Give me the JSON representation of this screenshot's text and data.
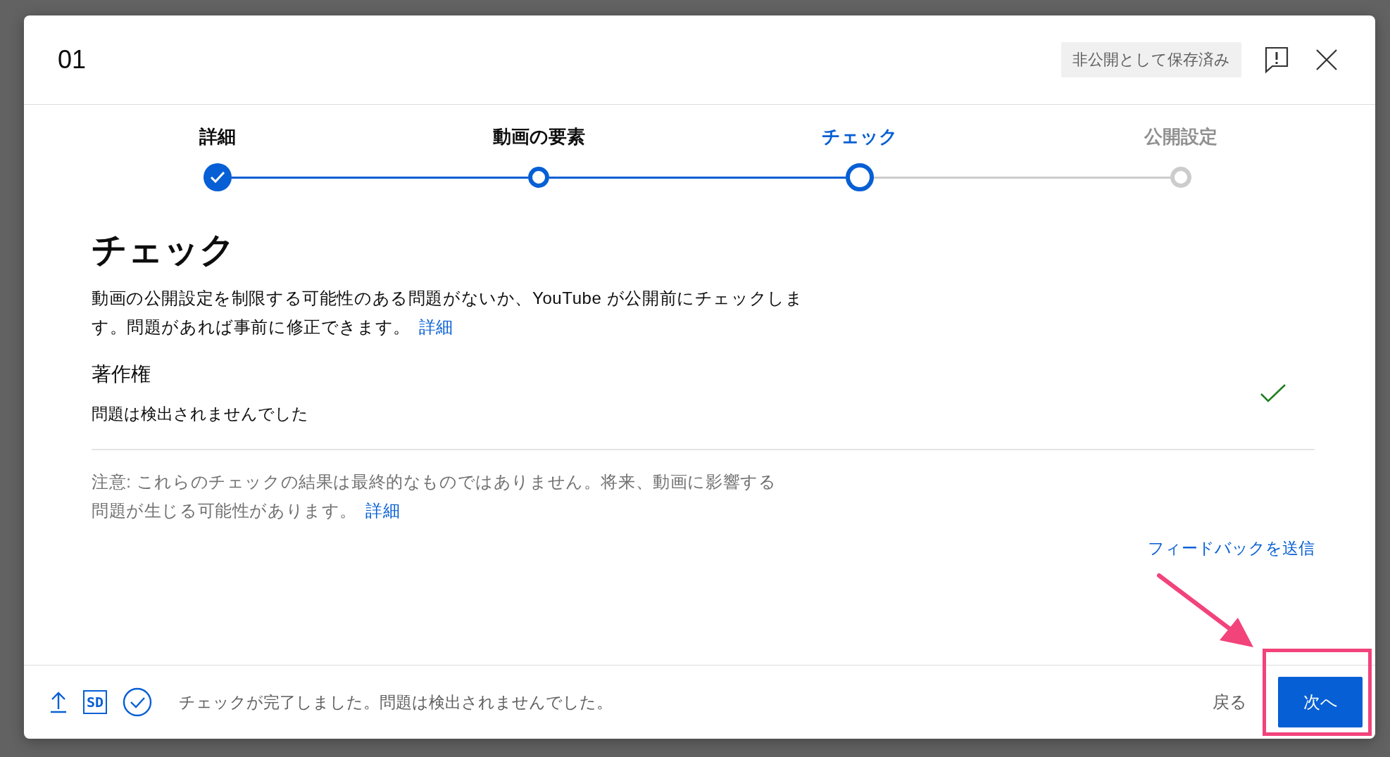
{
  "dialog": {
    "title": "01",
    "save_status": "非公開として保存済み"
  },
  "steps": [
    {
      "label": "詳細",
      "checked": true,
      "completed": true,
      "selected": false
    },
    {
      "label": "動画の要素",
      "checked": false,
      "completed": true,
      "selected": false
    },
    {
      "label": "チェック",
      "checked": false,
      "completed": false,
      "selected": true
    },
    {
      "label": "公開設定",
      "checked": false,
      "completed": false,
      "selected": false
    }
  ],
  "content": {
    "heading": "チェック",
    "description": "動画の公開設定を制限する可能性のある問題がないか、YouTube が公開前にチェックします。問題があれば事前に修正できます。",
    "description_link": "詳細",
    "checks": [
      {
        "title": "著作権",
        "result": "問題は検出されませんでした",
        "passed": true
      }
    ],
    "note": "注意: これらのチェックの結果は最終的なものではありません。将来、動画に影響する問題が生じる可能性があります。",
    "note_link": "詳細",
    "feedback_link": "フィードバックを送信"
  },
  "footer": {
    "quality": "SD",
    "status": "チェックが完了しました。問題は検出されませんでした。",
    "back": "戻る",
    "next": "次へ"
  },
  "annotation": {
    "highlight": true
  }
}
